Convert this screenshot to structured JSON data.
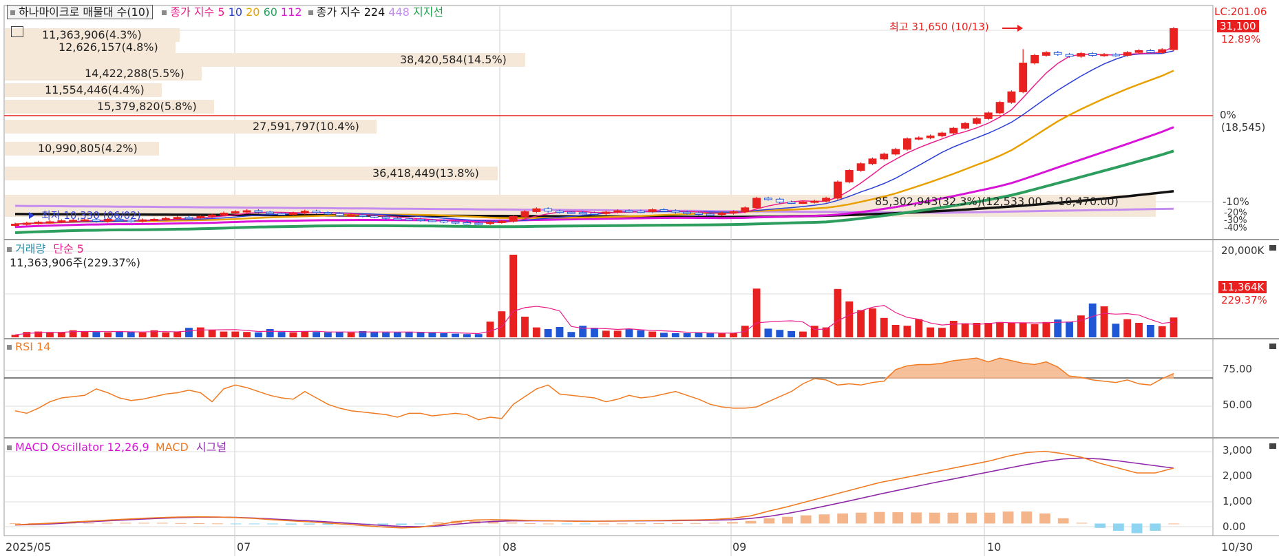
{
  "title_tab": "하나마이크로 매물대 수(10)",
  "legend_price": {
    "label": "종가 지수",
    "periods": [
      {
        "text": "5",
        "color": "#e91e8c"
      },
      {
        "text": "10",
        "color": "#2c3fd6"
      },
      {
        "text": "20",
        "color": "#e8a000"
      },
      {
        "text": "60",
        "color": "#2e9e5e"
      },
      {
        "text": "112",
        "color": "#d814d8"
      }
    ],
    "label2": "종가 지수 224",
    "p448": "448",
    "support": "지지선"
  },
  "price_axis": {
    "lc": "LC:201.06",
    "current": "31,100",
    "current_pct": "12.89%",
    "zero": "0%",
    "zero_val": "(18,545)",
    "ticks": [
      "-10%",
      "-20%",
      "-30%",
      "-40%"
    ]
  },
  "annotations": {
    "high": "최고 31,650 (10/13)",
    "low": "최저 10,330 (06/02)"
  },
  "volume_profile": [
    {
      "text": "11,363,906(4.3%)"
    },
    {
      "text": "12,626,157(4.8%)"
    },
    {
      "text": "38,420,584(14.5%)"
    },
    {
      "text": "14,422,288(5.5%)"
    },
    {
      "text": "11,554,446(4.4%)"
    },
    {
      "text": "15,379,820(5.8%)"
    },
    {
      "text": "27,591,797(10.4%)"
    },
    {
      "text": "10,990,805(4.2%)"
    },
    {
      "text": "36,418,449(13.8%)"
    },
    {
      "text": "85,302,943(32.3%)(12,533.00 ~ 10,470.00)"
    }
  ],
  "volume_panel": {
    "title": "거래량",
    "ma": "단순 5",
    "info": "11,363,906주(229.37%)",
    "axis_top": "20,000K",
    "current": "11,364K",
    "current_pct": "229.37%"
  },
  "rsi_panel": {
    "title": "RSI 14",
    "ticks": [
      "75.00",
      "50.00"
    ]
  },
  "macd_panel": {
    "title": "MACD Oscillator 12,26,9",
    "macd": "MACD",
    "signal": "시그널",
    "ticks": [
      "3,000",
      "2,000",
      "1,000",
      "0.00"
    ]
  },
  "x_labels": [
    "2025/05",
    "07",
    "08",
    "09",
    "10",
    "10/30"
  ],
  "chart_data": [
    {
      "type": "candlestick",
      "title": "하나마이크로",
      "dates_first": "2025/05",
      "dates_last": "10/30",
      "close_series": [
        10700,
        10800,
        10900,
        10950,
        11050,
        11100,
        11150,
        11000,
        11200,
        11100,
        11000,
        11150,
        11200,
        11300,
        11400,
        11350,
        11500,
        11650,
        11850,
        12000,
        12100,
        11950,
        11800,
        11750,
        11850,
        12050,
        11900,
        11800,
        11600,
        11650,
        11550,
        11450,
        11300,
        11250,
        11200,
        11100,
        11050,
        10950,
        10850,
        10800,
        10750,
        10900,
        11000,
        11500,
        12000,
        12300,
        12050,
        11950,
        11900,
        11850,
        11800,
        11950,
        12100,
        12050,
        12000,
        12200,
        12100,
        11950,
        11850,
        11750,
        11700,
        11850,
        12000,
        12400,
        13400,
        13300,
        13000,
        12950,
        13000,
        13100,
        13400,
        15100,
        16300,
        17000,
        17500,
        18000,
        18500,
        19600,
        19700,
        19900,
        20200,
        20700,
        21200,
        21700,
        22300,
        23400,
        24500,
        27500,
        28300,
        28600,
        28400,
        28200,
        28500,
        28300,
        28400,
        28300,
        28600,
        28800,
        28600,
        28900,
        31100
      ],
      "ma_color": {
        "5": "#e91e8c",
        "10": "#2c3fd6",
        "20": "#e8a000",
        "60": "#2e9e5e",
        "112": "#d814d8",
        "224": "#111111",
        "448": "#c58cf0"
      },
      "high": 31650,
      "low": 10330
    },
    {
      "type": "bar",
      "title": "거래량",
      "unit": "K",
      "ylim": [
        0,
        20000
      ],
      "values": [
        600,
        1300,
        1400,
        1300,
        1300,
        1700,
        1400,
        1300,
        1200,
        1500,
        1300,
        1200,
        1700,
        1200,
        1300,
        2300,
        2400,
        1800,
        1400,
        1400,
        1300,
        1200,
        2000,
        1300,
        1200,
        1500,
        1300,
        1200,
        1300,
        1200,
        1500,
        1300,
        1200,
        1200,
        1300,
        1200,
        1100,
        1000,
        900,
        800,
        800,
        3800,
        6300,
        20000,
        5000,
        2400,
        2000,
        2500,
        1300,
        2800,
        2300,
        1600,
        1600,
        2000,
        1700,
        1400,
        1100,
        1000,
        1000,
        1200,
        1000,
        1000,
        1000,
        2800,
        11800,
        2100,
        1800,
        1500,
        1400,
        2800,
        2400,
        11700,
        8700,
        6600,
        7000,
        4700,
        3000,
        2800,
        4400,
        2400,
        2300,
        4000,
        3400,
        3500,
        3500,
        3700,
        3500,
        3500,
        3200,
        3700,
        4300,
        3800,
        5300,
        8200,
        7500,
        3300,
        4400,
        3500,
        3000,
        2700,
        4800
      ],
      "ma": "단순 5"
    },
    {
      "type": "line",
      "title": "RSI 14",
      "ylim": [
        25,
        100
      ],
      "values": [
        45,
        43,
        47,
        52,
        55,
        56,
        57,
        62,
        59,
        55,
        53,
        54,
        56,
        58,
        59,
        61,
        59,
        52,
        62,
        65,
        63,
        60,
        57,
        55,
        54,
        60,
        55,
        50,
        47,
        45,
        44,
        43,
        42,
        40,
        43,
        43,
        41,
        42,
        43,
        42,
        38,
        40,
        39,
        50,
        56,
        62,
        65,
        58,
        57,
        56,
        55,
        52,
        54,
        57,
        55,
        56,
        58,
        60,
        57,
        54,
        50,
        48,
        47,
        47,
        48,
        52,
        56,
        60,
        66,
        70,
        69,
        65,
        66,
        65,
        67,
        68,
        77,
        80,
        81,
        81,
        82,
        84,
        85,
        86,
        83,
        86,
        84,
        82,
        81,
        83,
        79,
        72,
        71,
        69,
        68,
        67,
        69,
        66,
        65,
        70,
        74
      ],
      "level": 70
    },
    {
      "type": "line",
      "title": "MACD Oscillator 12,26,9",
      "ylim": [
        -500,
        3500
      ],
      "series": [
        {
          "name": "MACD",
          "values": [
            -50,
            -20,
            20,
            60,
            100,
            140,
            180,
            220,
            250,
            270,
            280,
            270,
            250,
            210,
            160,
            110,
            70,
            20,
            -30,
            -90,
            -140,
            -180,
            -150,
            -50,
            80,
            150,
            160,
            150,
            130,
            110,
            100,
            90,
            100,
            110,
            120,
            130,
            140,
            150,
            170,
            220,
            320,
            520,
            700,
            900,
            1100,
            1300,
            1500,
            1700,
            1850,
            2000,
            2150,
            2300,
            2450,
            2600,
            2800,
            2950,
            3000,
            2900,
            2750,
            2500,
            2300,
            2100,
            2100,
            2300
          ]
        },
        {
          "name": "시그널",
          "values": [
            -60,
            -40,
            -10,
            30,
            70,
            110,
            150,
            190,
            220,
            250,
            265,
            265,
            255,
            230,
            190,
            150,
            110,
            70,
            20,
            -30,
            -80,
            -120,
            -130,
            -100,
            -30,
            40,
            90,
            110,
            115,
            110,
            105,
            100,
            100,
            105,
            110,
            115,
            120,
            130,
            140,
            160,
            210,
            300,
            420,
            560,
            720,
            880,
            1050,
            1220,
            1380,
            1540,
            1700,
            1850,
            2000,
            2150,
            2300,
            2450,
            2580,
            2680,
            2720,
            2680,
            2600,
            2500,
            2400,
            2300
          ]
        }
      ],
      "oscillator": [
        10,
        20,
        30,
        30,
        30,
        30,
        30,
        30,
        30,
        20,
        15,
        5,
        -5,
        -20,
        -30,
        -40,
        -40,
        -50,
        -50,
        -60,
        -60,
        -60,
        -20,
        50,
        110,
        110,
        70,
        40,
        15,
        0,
        -5,
        -10,
        0,
        5,
        10,
        15,
        20,
        20,
        30,
        60,
        110,
        220,
        280,
        340,
        380,
        420,
        450,
        480,
        470,
        460,
        450,
        450,
        450,
        450,
        500,
        500,
        420,
        220,
        30,
        -180,
        -300,
        -400,
        -300,
        0
      ]
    }
  ]
}
